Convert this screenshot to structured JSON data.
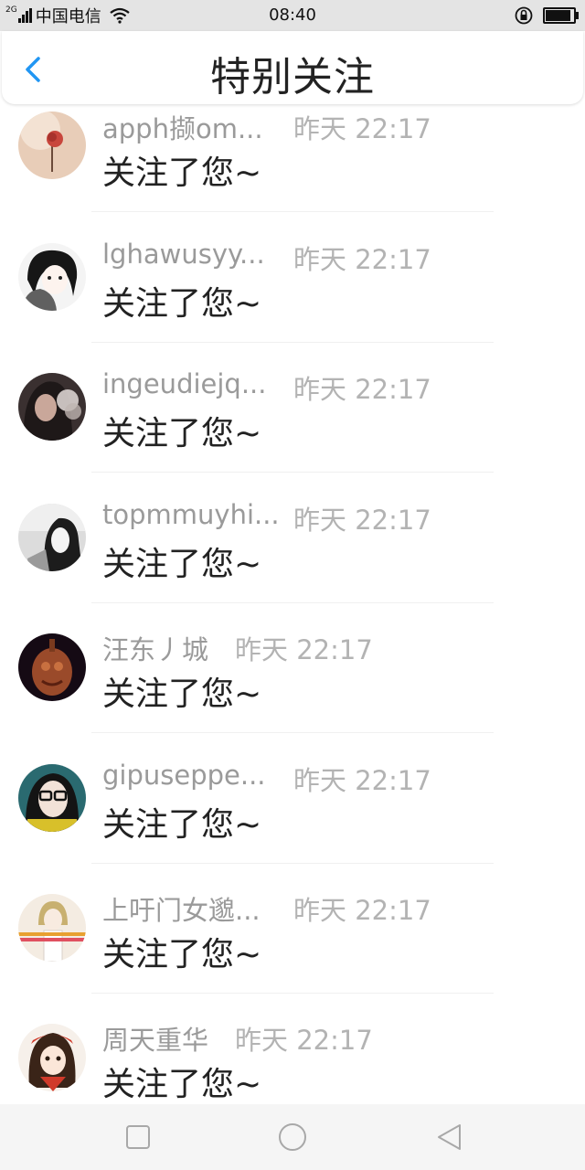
{
  "status_bar": {
    "network_tag": "2G",
    "carrier": "中国电信",
    "time": "08:40"
  },
  "header": {
    "title": "特别关注",
    "back_icon": "chevron-left-icon",
    "accent_color": "#2196F3"
  },
  "items": [
    {
      "name": "apph撷om...",
      "time": "昨天 22:17",
      "message": "关注了您~"
    },
    {
      "name": "lghawusyy...",
      "time": "昨天 22:17",
      "message": "关注了您~"
    },
    {
      "name": "ingeudiejq...",
      "time": "昨天 22:17",
      "message": "关注了您~"
    },
    {
      "name": "topmmuyhi...",
      "time": "昨天 22:17",
      "message": "关注了您~"
    },
    {
      "name": "汪东丿城",
      "time": "昨天 22:17",
      "message": "关注了您~"
    },
    {
      "name": "gipuseppe...",
      "time": "昨天 22:17",
      "message": "关注了您~"
    },
    {
      "name": "上吁门女邈...",
      "time": "昨天 22:17",
      "message": "关注了您~"
    },
    {
      "name": "周天重华",
      "time": "昨天 22:17",
      "message": "关注了您~"
    }
  ],
  "nav_bar": {
    "recents_icon": "square-icon",
    "home_icon": "circle-icon",
    "back_icon": "triangle-back-icon"
  }
}
